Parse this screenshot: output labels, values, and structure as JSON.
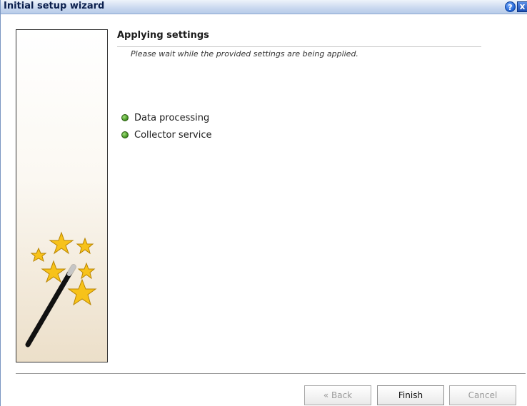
{
  "window": {
    "title": "Initial setup wizard",
    "help_glyph": "?",
    "close_glyph": "x"
  },
  "page": {
    "heading": "Applying settings",
    "subtitle": "Please wait while the provided settings are being applied."
  },
  "status_items": [
    {
      "label": "Data processing",
      "icon": "green-status-icon",
      "color": "#3f8f1d"
    },
    {
      "label": "Collector service",
      "icon": "green-status-icon",
      "color": "#3f8f1d"
    }
  ],
  "buttons": {
    "back": "« Back",
    "finish": "Finish",
    "cancel": "Cancel"
  },
  "colors": {
    "title_bar": "#c9d8ef",
    "star": "#f7c21a",
    "wand": "#111111"
  },
  "icons": {
    "help": "help-icon",
    "close": "close-icon",
    "wizard_art": "magic-wand-icon"
  }
}
